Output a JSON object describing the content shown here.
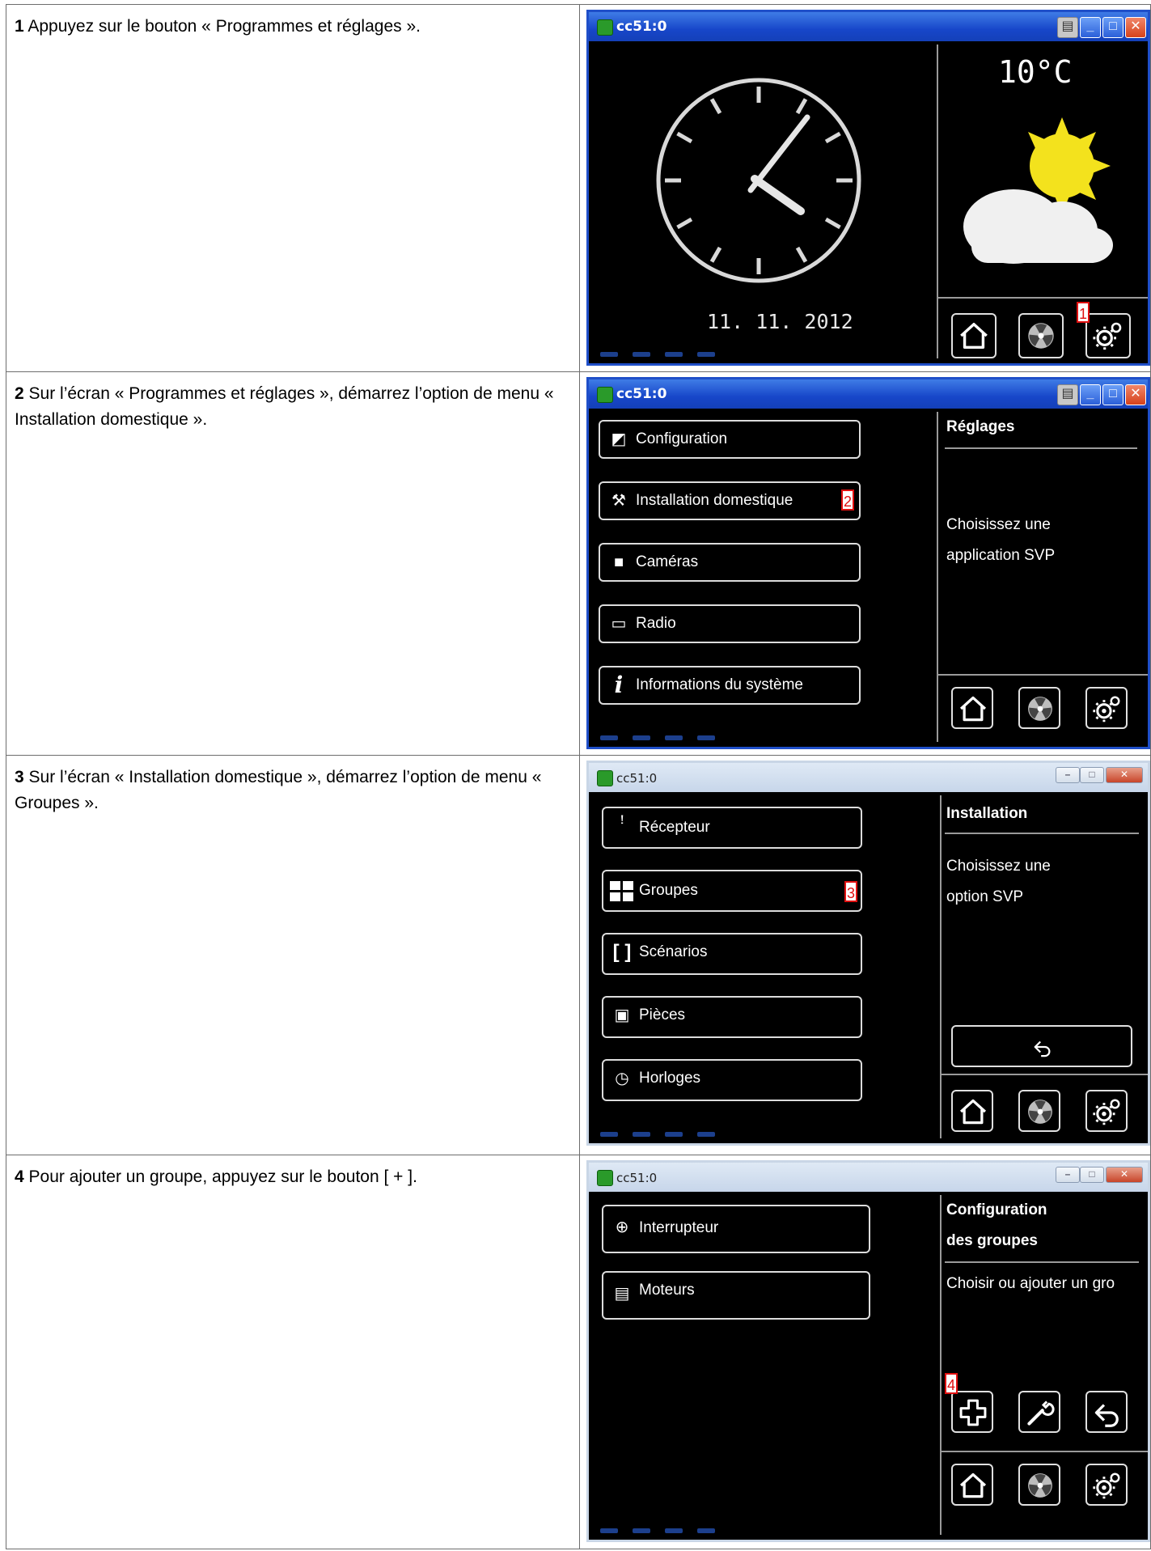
{
  "steps": [
    {
      "number": "1",
      "text": "Appuyez sur le bouton « Programmes et réglages ».",
      "screen": {
        "title": "cc51:0",
        "temperature": "10°C",
        "date": "11. 11. 2012",
        "callout": "1"
      }
    },
    {
      "number": "2",
      "text": "Sur l’écran « Programmes et réglages », démarrez l’option de menu « Installation domestique ».",
      "screen": {
        "title": "cc51:0",
        "menu": [
          "Configuration",
          "Installation domestique",
          "Caméras",
          "Radio",
          "Informations du système"
        ],
        "side_title": "Réglages",
        "side_text_1": "Choisissez une",
        "side_text_2": "application SVP",
        "callout": "2"
      }
    },
    {
      "number": "3",
      "text": "Sur l’écran « Installation domestique », démarrez l’option de menu « Groupes ».",
      "screen": {
        "title": "cc51:0",
        "menu": [
          "Récepteur",
          "Groupes",
          "Scénarios",
          "Pièces",
          "Horloges"
        ],
        "side_title": "Installation",
        "side_text_1": "Choisissez une",
        "side_text_2": "option SVP",
        "callout": "3"
      }
    },
    {
      "number": "4",
      "text": "Pour ajouter un groupe, appuyez sur le bouton [ + ].",
      "screen": {
        "title": "cc51:0",
        "menu": [
          "Interrupteur",
          "Moteurs"
        ],
        "side_title_1": "Configuration",
        "side_title_2": "des groupes",
        "side_text": "Choisir ou ajouter un gro",
        "callout": "4"
      }
    }
  ],
  "icons": {
    "home": "house-icon",
    "programs": "fan-icon",
    "settings": "gear-icon",
    "back": "back-arrow-icon",
    "add": "plus-icon",
    "tool": "wrench-icon"
  }
}
